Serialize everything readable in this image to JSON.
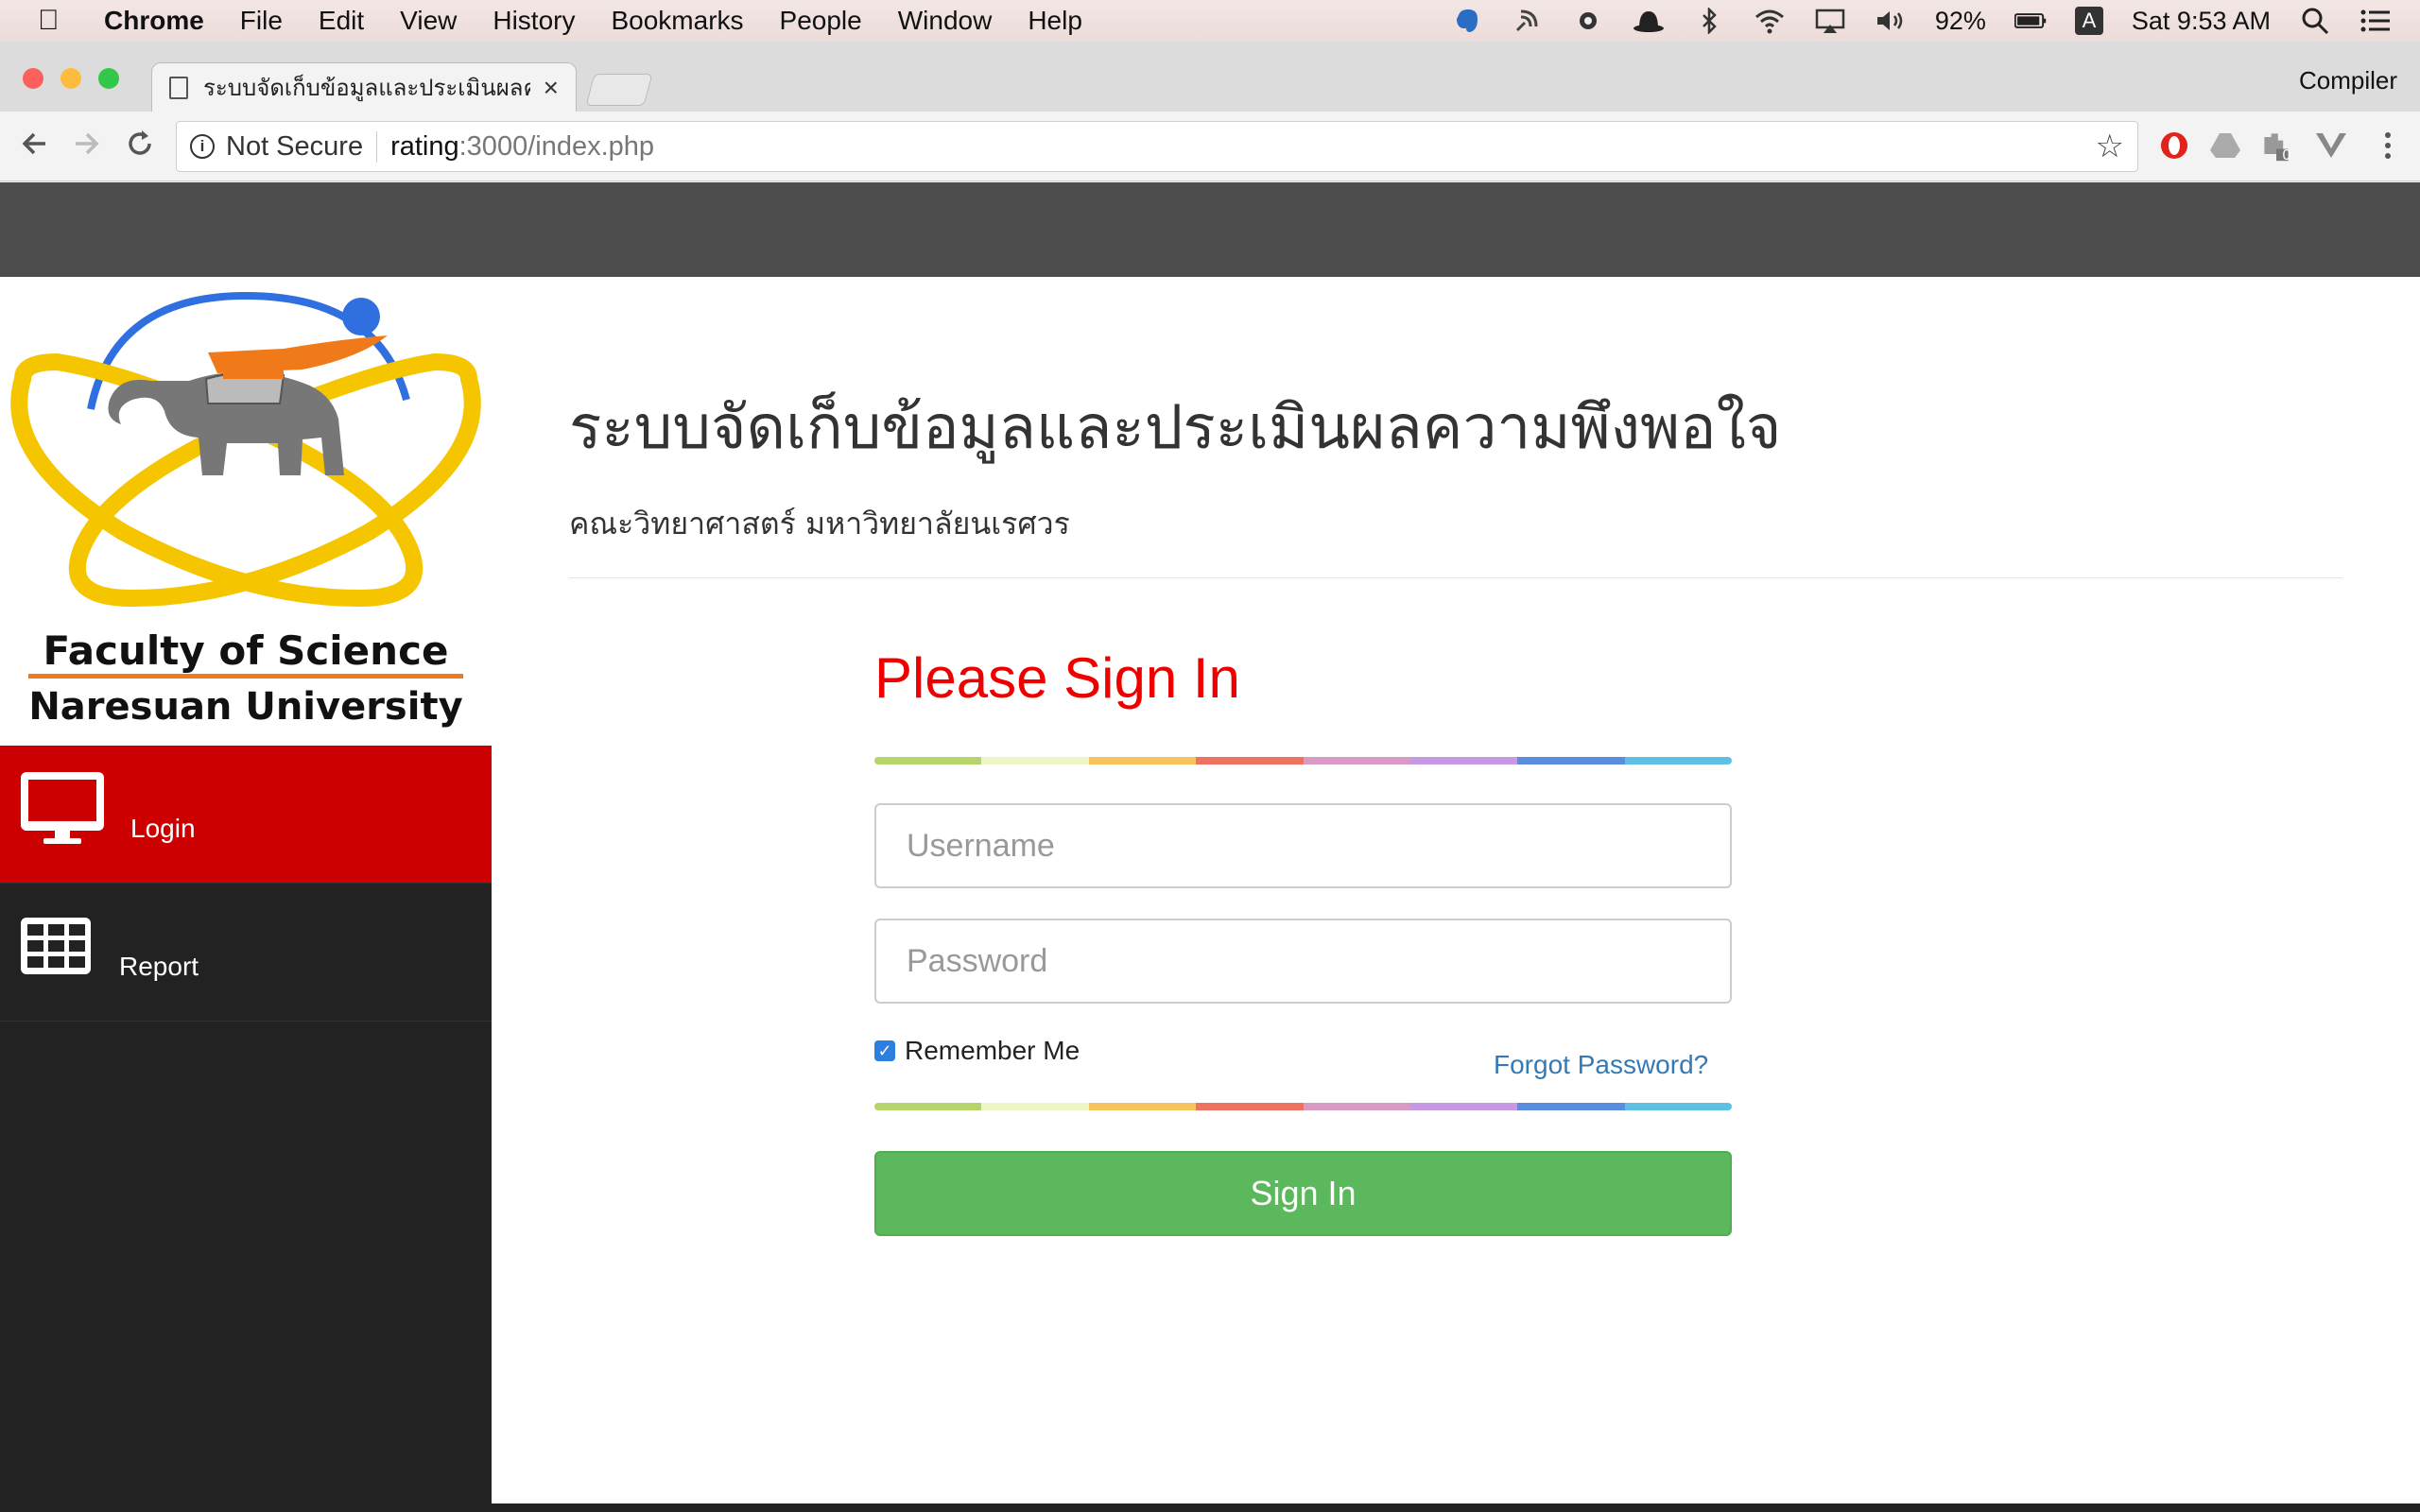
{
  "menubar": {
    "app_name": "Chrome",
    "items": [
      "File",
      "Edit",
      "View",
      "History",
      "Bookmarks",
      "People",
      "Window",
      "Help"
    ],
    "battery": "92%",
    "input_source": "A",
    "clock": "Sat 9:53 AM"
  },
  "browser": {
    "tab_title": "ระบบจัดเก็บข้อมูลและประเมินผลควา",
    "profile_name": "Compiler",
    "security_label": "Not Secure",
    "url_host": "rating",
    "url_path": ":3000/index.php",
    "extension_badge": "0"
  },
  "sidebar": {
    "logo_line1": "Faculty of Science",
    "logo_line2": "Naresuan University",
    "items": [
      {
        "label": "Login",
        "icon": "monitor-icon",
        "active": true
      },
      {
        "label": "Report",
        "icon": "grid-icon",
        "active": false
      }
    ]
  },
  "main": {
    "heading": "ระบบจัดเก็บข้อมูลและประเมินผลความพึงพอใจ",
    "subheading": "คณะวิทยาศาสตร์ มหาวิทยาลัยนเรศวร",
    "form": {
      "title": "Please Sign In",
      "username_placeholder": "Username",
      "password_placeholder": "Password",
      "remember_label": "Remember Me",
      "remember_checked": true,
      "forgot_label": "Forgot Password?",
      "submit_label": "Sign In"
    },
    "rainbow_colors": [
      "#b5d56a",
      "#eef5c6",
      "#f7c45c",
      "#ee7261",
      "#d99ac4",
      "#c59ae3",
      "#5a8de0",
      "#5ec1e4"
    ]
  },
  "colors": {
    "accent_red": "#cc0000",
    "title_red": "#ee0000",
    "button_green": "#5cb85c",
    "link_blue": "#337ab7",
    "sidebar_bg": "#222222",
    "topbar_bg": "#4d4d4d"
  }
}
